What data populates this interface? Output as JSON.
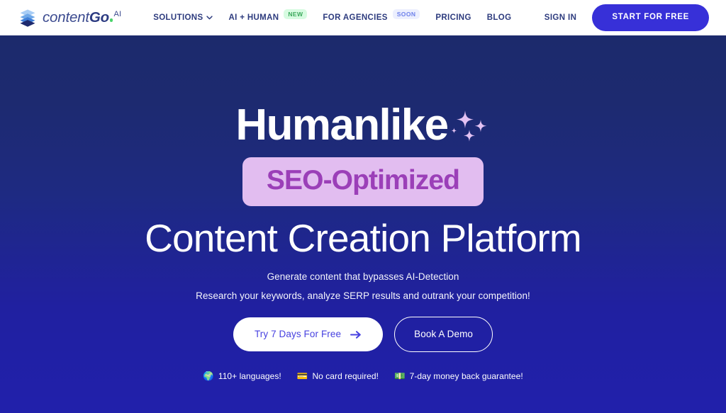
{
  "navbar": {
    "brand": {
      "icon": "stacked-layers-icon",
      "text_light": "content",
      "text_bold": "Go",
      "superscript": "AI",
      "dot_color": "#4ad36a",
      "text_color": "#3b4a8f"
    },
    "links": [
      {
        "label": "SOLUTIONS",
        "icon": "chevron-down-icon",
        "badge": null
      },
      {
        "label": "AI + HUMAN",
        "icon": null,
        "badge": "NEW",
        "badge_kind": "new"
      },
      {
        "label": "FOR AGENCIES",
        "icon": null,
        "badge": "SOON",
        "badge_kind": "soon"
      },
      {
        "label": "PRICING",
        "icon": null,
        "badge": null
      },
      {
        "label": "BLOG",
        "icon": null,
        "badge": null
      }
    ],
    "sign_in_label": "SIGN IN",
    "start_button_label": "START FOR FREE",
    "start_button_color": "#3730d8"
  },
  "hero": {
    "headline_word": "Humanlike",
    "sparkle_icon": "sparkles-icon",
    "sparkle_color": "#e3c2f3",
    "pill_label": "SEO-Optimized",
    "pill_bg": "#e2bdf0",
    "pill_text_color": "#9b3fb8",
    "headline_line3": "Content Creation Platform",
    "subtitle_1": "Generate content that bypasses AI-Detection",
    "subtitle_2": "Research your keywords, analyze SERP results and outrank your competition!",
    "primary_cta": {
      "label": "Try 7 Days For Free",
      "icon": "arrow-right-icon",
      "text_color": "#4741e0"
    },
    "secondary_cta": {
      "label": "Book A Demo"
    },
    "features": [
      {
        "emoji": "🌍",
        "icon": "globe-icon",
        "label": "110+ languages!"
      },
      {
        "emoji": "💳",
        "icon": "credit-card-icon",
        "label": "No card required!"
      },
      {
        "emoji": "💵",
        "icon": "money-icon",
        "label": "7-day money back guarantee!"
      }
    ],
    "background_gradient_top": "#1c2a6c",
    "background_gradient_bottom": "#2120ab"
  }
}
